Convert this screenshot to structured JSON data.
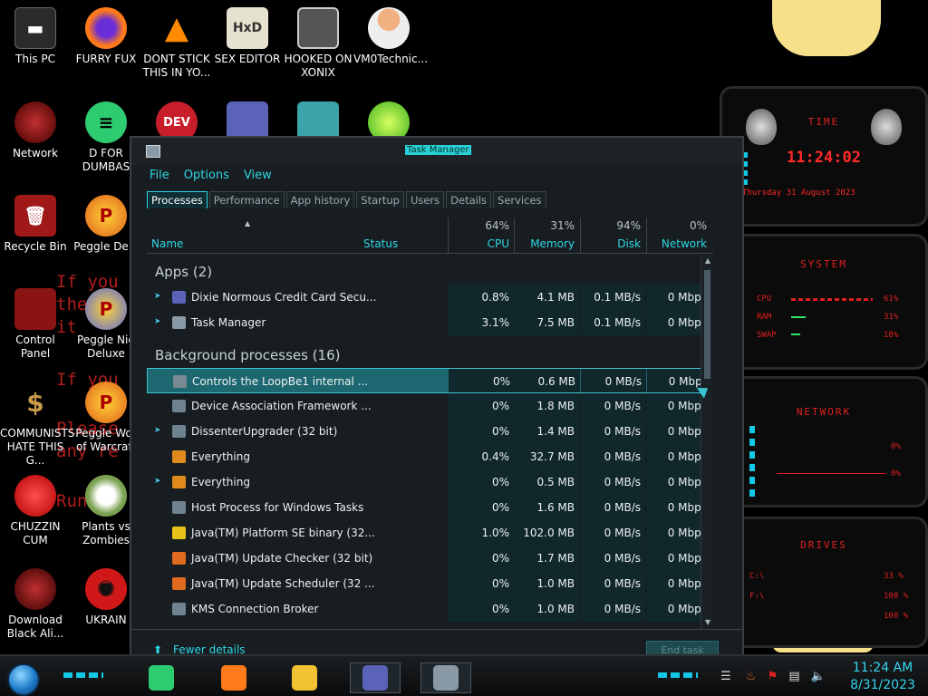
{
  "desktop": {
    "icons": [
      {
        "label": "This PC",
        "icon": "computer-icon"
      },
      {
        "label": "FURRY FUX",
        "icon": "firefox-icon"
      },
      {
        "label": "DONT STICK THIS IN YO...",
        "icon": "vlc-icon"
      },
      {
        "label": "SEX EDITOR",
        "icon": "hxd-editor-icon"
      },
      {
        "label": "HOOKED ON XONIX",
        "icon": "xonix-game-icon"
      },
      {
        "label": "VM0Technic...",
        "icon": "doctor-icon"
      },
      {
        "label": "Network",
        "icon": "network-icon"
      },
      {
        "label": "D FOR DUMBAS",
        "icon": "d-app-icon"
      },
      {
        "label": "Recycle Bin",
        "icon": "recycle-bin-icon"
      },
      {
        "label": "Peggle Delu",
        "icon": "peggle-icon"
      },
      {
        "label": "Control Panel",
        "icon": "control-panel-icon"
      },
      {
        "label": "Peggle Nig Deluxe",
        "icon": "peggle-nights-icon"
      },
      {
        "label": "COMMUNISTS HATE THIS G...",
        "icon": "money-bag-icon"
      },
      {
        "label": "Peggle Wor of Warcraft",
        "icon": "peggle-wow-icon"
      },
      {
        "label": "CHUZZIN CUM",
        "icon": "chuzzle-icon"
      },
      {
        "label": "Plants vs Zombies",
        "icon": "pvz-icon"
      },
      {
        "label": "Download Black Ali...",
        "icon": "alienware-icon"
      },
      {
        "label": "UKRAIN",
        "icon": "radiation-icon"
      }
    ],
    "row2_partial_icons": [
      "dev-cpp-icon",
      "credit-card-icon",
      "santa-icon",
      "lime-icon"
    ],
    "background_text": [
      "If you",
      "the v",
      "it",
      "If you",
      "Please",
      "any re",
      "Run an"
    ]
  },
  "gadget": {
    "time_title": "TIME",
    "time": "11:24:02",
    "date": "Thursday 31 August 2023",
    "system_title": "SYSTEM",
    "system_rows": [
      {
        "label": "CPU",
        "value": "61%"
      },
      {
        "label": "RAM",
        "value": "31%"
      },
      {
        "label": "SWAP",
        "value": "18%"
      }
    ],
    "network_title": "NETWORK",
    "network_rows": [
      {
        "value": "0%"
      },
      {
        "value": "0%"
      }
    ],
    "drives_title": "DRIVES",
    "drive_rows": [
      {
        "label": "C:\\",
        "value": "33 %"
      },
      {
        "label": "F:\\",
        "value": "100 %"
      },
      {
        "label": "",
        "value": "100 %"
      }
    ]
  },
  "taskmgr": {
    "title": "Task Manager",
    "menu": [
      "File",
      "Options",
      "View"
    ],
    "tabs": [
      "Processes",
      "Performance",
      "App history",
      "Startup",
      "Users",
      "Details",
      "Services"
    ],
    "columns": {
      "name": "Name",
      "status": "Status",
      "cpu": {
        "pct": "64%",
        "label": "CPU"
      },
      "memory": {
        "pct": "31%",
        "label": "Memory"
      },
      "disk": {
        "pct": "94%",
        "label": "Disk"
      },
      "network": {
        "pct": "0%",
        "label": "Network"
      }
    },
    "apps_group": "Apps (2)",
    "apps": [
      {
        "name": "Dixie Normous Credit Card Secu...",
        "cpu": "0.8%",
        "mem": "4.1 MB",
        "disk": "0.1 MB/s",
        "net": "0 Mbps",
        "expand": true,
        "icon": "credit-card-icon",
        "color": "#5b63b8"
      },
      {
        "name": "Task Manager",
        "cpu": "3.1%",
        "mem": "7.5 MB",
        "disk": "0.1 MB/s",
        "net": "0 Mbps",
        "expand": true,
        "icon": "task-manager-icon",
        "color": "#8a99a6"
      }
    ],
    "bg_group": "Background processes (16)",
    "background": [
      {
        "name": "Controls the LoopBe1 internal ...",
        "cpu": "0%",
        "mem": "0.6 MB",
        "disk": "0 MB/s",
        "net": "0 Mbps",
        "expand": false,
        "icon": "speaker-icon",
        "color": "#7a8a94",
        "selected": true
      },
      {
        "name": "Device Association Framework ...",
        "cpu": "0%",
        "mem": "1.8 MB",
        "disk": "0 MB/s",
        "net": "0 Mbps",
        "expand": false,
        "icon": "window-icon",
        "color": "#6f8290"
      },
      {
        "name": "DissenterUpgrader (32 bit)",
        "cpu": "0%",
        "mem": "1.4 MB",
        "disk": "0 MB/s",
        "net": "0 Mbps",
        "expand": true,
        "icon": "window-icon",
        "color": "#6f8290"
      },
      {
        "name": "Everything",
        "cpu": "0.4%",
        "mem": "32.7 MB",
        "disk": "0 MB/s",
        "net": "0 Mbps",
        "expand": false,
        "icon": "magnifier-icon",
        "color": "#e08a1e"
      },
      {
        "name": "Everything",
        "cpu": "0%",
        "mem": "0.5 MB",
        "disk": "0 MB/s",
        "net": "0 Mbps",
        "expand": true,
        "icon": "magnifier-icon",
        "color": "#e08a1e"
      },
      {
        "name": "Host Process for Windows Tasks",
        "cpu": "0%",
        "mem": "1.6 MB",
        "disk": "0 MB/s",
        "net": "0 Mbps",
        "expand": false,
        "icon": "window-icon",
        "color": "#6f8290"
      },
      {
        "name": "Java(TM) Platform SE binary (32...",
        "cpu": "1.0%",
        "mem": "102.0 MB",
        "disk": "0 MB/s",
        "net": "0 Mbps",
        "expand": false,
        "icon": "star-icon",
        "color": "#e8c21c"
      },
      {
        "name": "Java(TM) Update Checker (32 bit)",
        "cpu": "0%",
        "mem": "1.7 MB",
        "disk": "0 MB/s",
        "net": "0 Mbps",
        "expand": false,
        "icon": "java-icon",
        "color": "#e06a1e"
      },
      {
        "name": "Java(TM) Update Scheduler (32 ...",
        "cpu": "0%",
        "mem": "1.0 MB",
        "disk": "0 MB/s",
        "net": "0 Mbps",
        "expand": false,
        "icon": "java-icon",
        "color": "#e06a1e"
      },
      {
        "name": "KMS Connection Broker",
        "cpu": "0%",
        "mem": "1.0 MB",
        "disk": "0 MB/s",
        "net": "0 Mbps",
        "expand": false,
        "icon": "window-icon",
        "color": "#6f8290"
      }
    ],
    "fewer_details": "Fewer details",
    "end_task": "End task"
  },
  "taskbar": {
    "time": "11:24 AM",
    "date": "8/31/2023",
    "pinned": [
      {
        "icon": "d-app-icon",
        "color": "#2ecc71",
        "open": false
      },
      {
        "icon": "firefox-icon",
        "color": "#ff7a1a",
        "open": false
      },
      {
        "icon": "file-explorer-icon",
        "color": "#f1c232",
        "open": false
      },
      {
        "icon": "credit-card-icon",
        "color": "#5b63b8",
        "open": true
      },
      {
        "icon": "task-manager-icon",
        "color": "#8a99a6",
        "open": true
      }
    ]
  }
}
